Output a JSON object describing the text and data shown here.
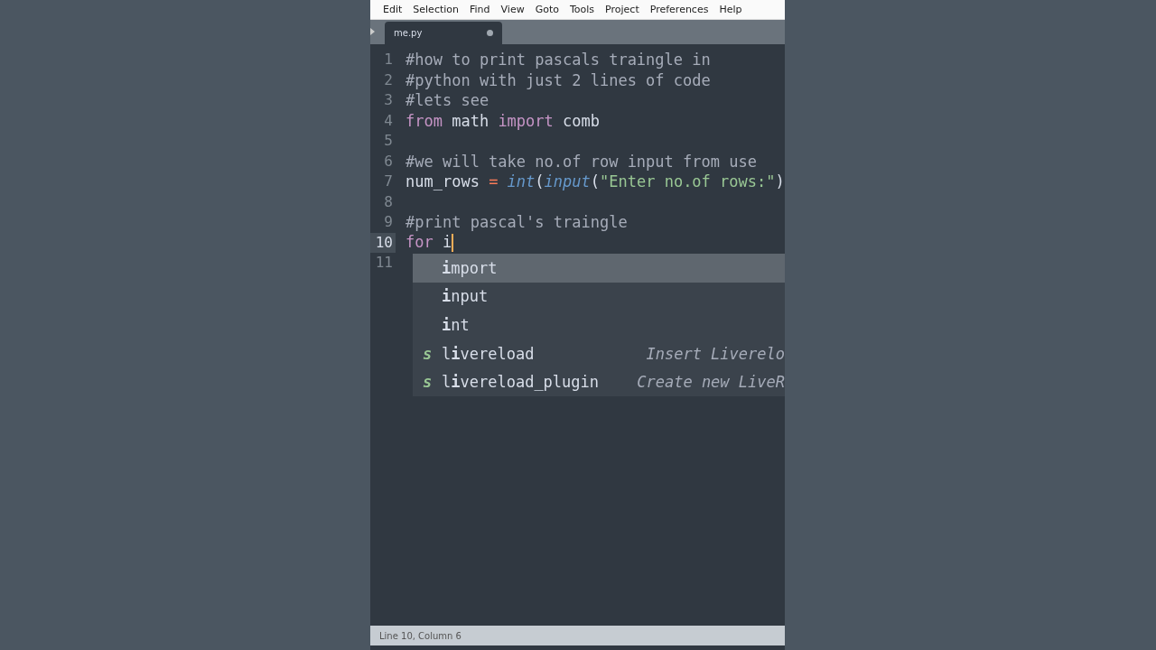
{
  "menu": [
    "Edit",
    "Selection",
    "Find",
    "View",
    "Goto",
    "Tools",
    "Project",
    "Preferences",
    "Help"
  ],
  "tabs": [
    {
      "label": "me.py",
      "selected": true,
      "modified": true
    }
  ],
  "lines": [
    {
      "number": "1",
      "current": false,
      "tokens": [
        {
          "kind": "comment",
          "text": "#how to print pascals traingle in"
        }
      ]
    },
    {
      "number": "2",
      "current": false,
      "tokens": [
        {
          "kind": "comment",
          "text": "#python with just 2 lines of code"
        }
      ]
    },
    {
      "number": "3",
      "current": false,
      "tokens": [
        {
          "kind": "comment",
          "text": "#lets see"
        }
      ]
    },
    {
      "number": "4",
      "current": false,
      "tokens": [
        {
          "kind": "keyword",
          "text": "from"
        },
        {
          "kind": "plain",
          "text": " math "
        },
        {
          "kind": "keyword",
          "text": "import"
        },
        {
          "kind": "plain",
          "text": " comb"
        }
      ]
    },
    {
      "number": "5",
      "current": false
    },
    {
      "number": "6",
      "current": false,
      "tokens": [
        {
          "kind": "comment",
          "text": "#we will take no.of row input from use"
        }
      ]
    },
    {
      "number": "7",
      "current": false,
      "tokens": [
        {
          "kind": "plain",
          "text": "num_rows "
        },
        {
          "kind": "operator",
          "text": "= "
        },
        {
          "kind": "builtin",
          "text": "int"
        },
        {
          "kind": "plain",
          "text": "("
        },
        {
          "kind": "builtin",
          "text": "input"
        },
        {
          "kind": "plain",
          "text": "("
        },
        {
          "kind": "string",
          "text": "\"Enter no.of rows:\""
        },
        {
          "kind": "plain",
          "text": ")"
        }
      ]
    },
    {
      "number": "8",
      "current": false
    },
    {
      "number": "9",
      "current": false,
      "tokens": [
        {
          "kind": "comment",
          "text": "#print pascal's traingle"
        }
      ]
    },
    {
      "number": "10",
      "current": true,
      "tokens": [
        {
          "kind": "keyword",
          "text": "for"
        },
        {
          "kind": "plain",
          "text": " i"
        }
      ]
    },
    {
      "number": "11",
      "current": false
    }
  ],
  "completions": [
    {
      "match": "i",
      "rest": "mport",
      "selected": true
    },
    {
      "match": "i",
      "rest": "nput",
      "selected": false
    },
    {
      "match": "i",
      "rest": "nt",
      "selected": false
    },
    {
      "kind": "snippet",
      "badge": "s",
      "prefix": "l",
      "match": "i",
      "rest": "vereload",
      "hint": "Insert Liverelo",
      "selected": false
    },
    {
      "kind": "snippet",
      "badge": "s",
      "prefix": "l",
      "match": "i",
      "rest": "vereload_plugin",
      "hint": "Create new LiveR",
      "selected": false
    }
  ],
  "status_bar": {
    "text": "Line 10, Column 6"
  }
}
